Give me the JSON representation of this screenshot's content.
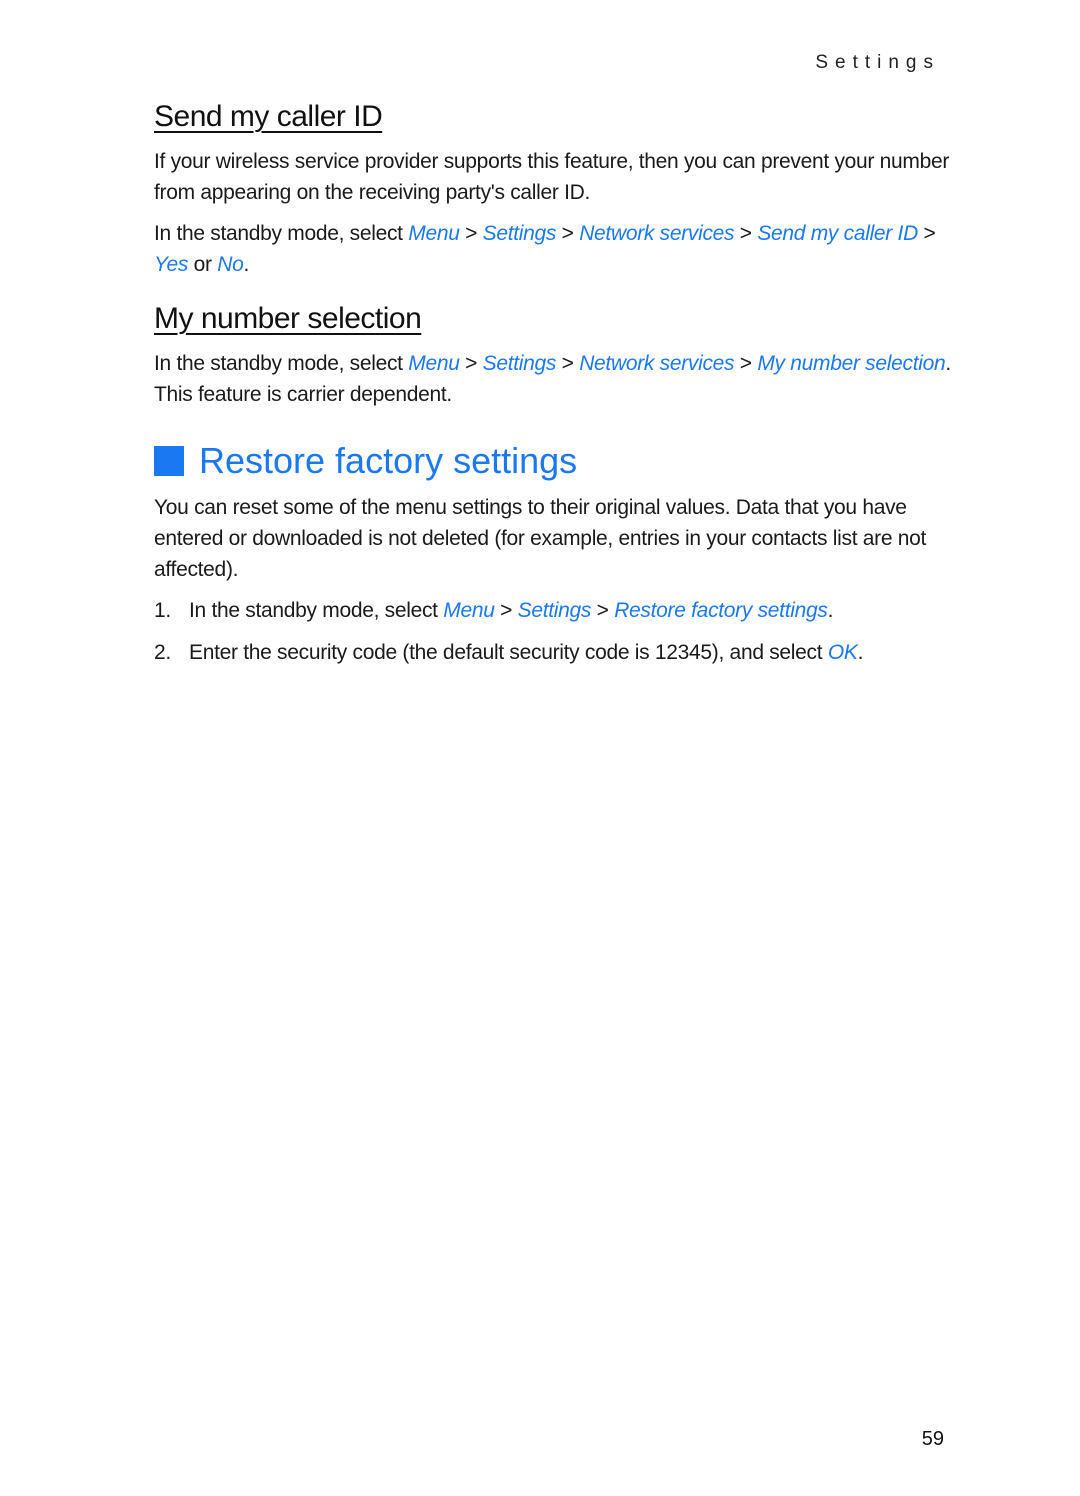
{
  "header": {
    "running_head": "Settings"
  },
  "sections": {
    "caller_id": {
      "title": "Send my caller ID",
      "para1": "If your wireless service provider supports this feature, then you can prevent your number from appearing on the receiving party's caller ID.",
      "para2_prefix": "In the standby mode, select ",
      "links": [
        "Menu",
        "Settings",
        "Network services",
        "Send my caller ID",
        "Yes",
        "No"
      ],
      "sep": " > ",
      "or": " or ",
      "end": "."
    },
    "number_selection": {
      "title": "My number selection",
      "prefix": "In the standby mode, select ",
      "links": [
        "Menu",
        "Settings",
        "Network services",
        "My number selection"
      ],
      "sep": " > ",
      "suffix": ". This feature is carrier dependent."
    },
    "restore": {
      "title": "Restore factory settings",
      "intro": "You can reset some of the menu settings to their original values. Data that you have entered or downloaded is not deleted (for example, entries in your contacts list are not affected).",
      "steps": [
        {
          "num": "1.",
          "prefix": "In the standby mode, select ",
          "links": [
            "Menu",
            "Settings",
            "Restore factory settings"
          ],
          "sep": " > ",
          "suffix": "."
        },
        {
          "num": "2.",
          "prefix": "Enter the security code (the default security code is ",
          "code": "12345",
          "mid": "), and select ",
          "link": "OK",
          "suffix": "."
        }
      ]
    }
  },
  "footer": {
    "page_number": "59"
  },
  "colors": {
    "accent": "#1a78f0"
  }
}
